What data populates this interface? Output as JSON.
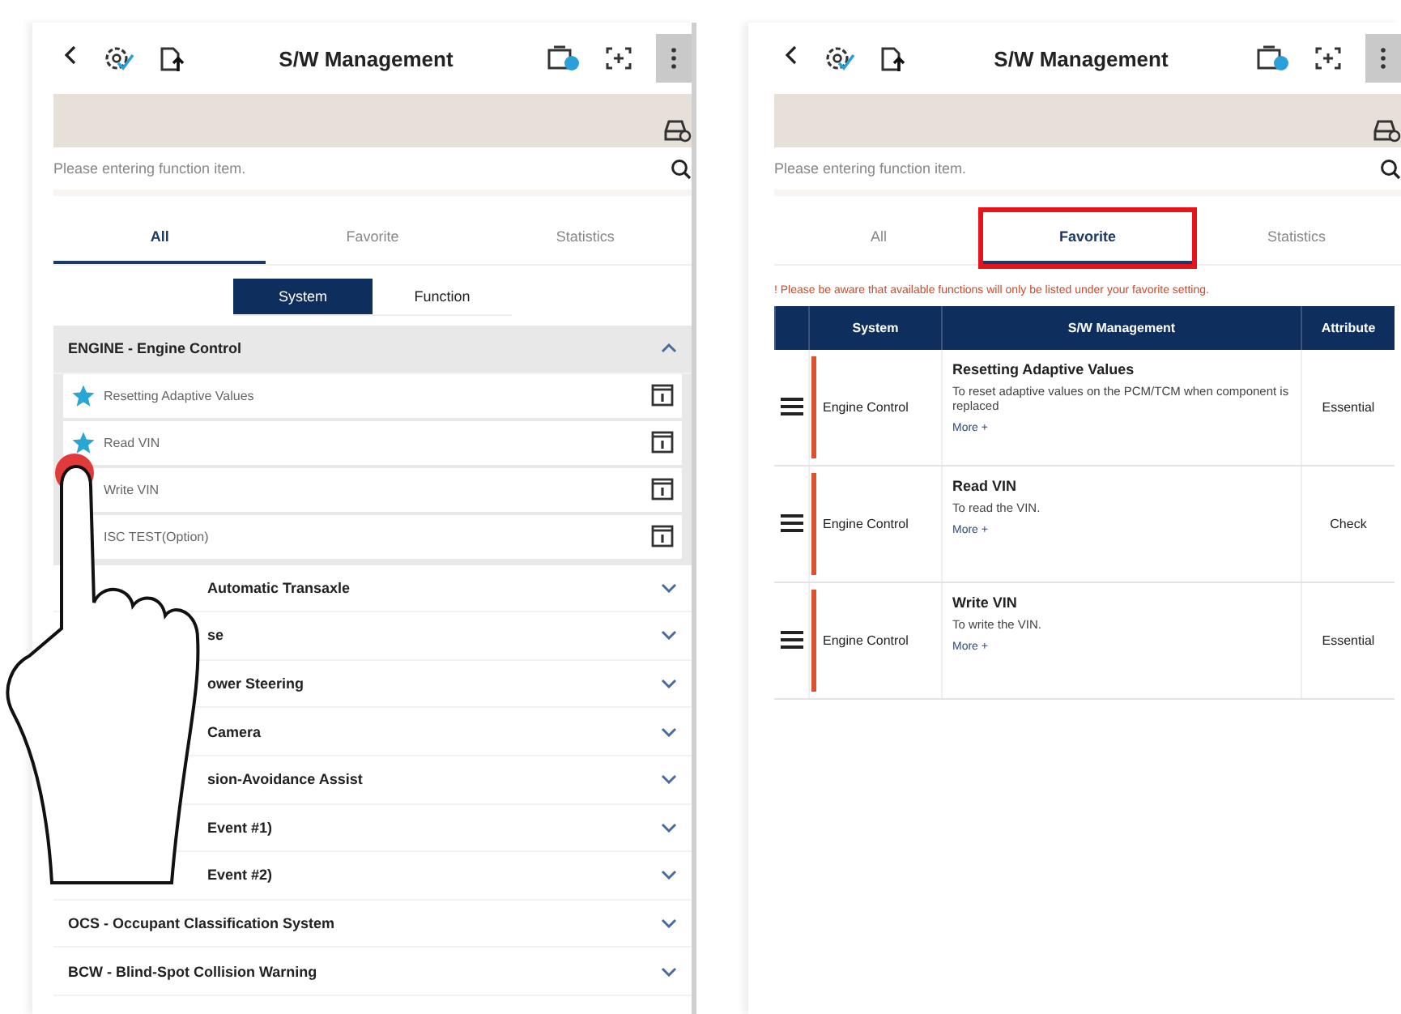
{
  "left_screen": {
    "header": {
      "title": "S/W Management"
    },
    "search": {
      "placeholder": "Please entering function item."
    },
    "tabs": [
      {
        "label": "All",
        "selected": true
      },
      {
        "label": "Favorite",
        "selected": false
      },
      {
        "label": "Statistics",
        "selected": false
      }
    ],
    "segments": [
      {
        "label": "System",
        "selected": true
      },
      {
        "label": "Function",
        "selected": false
      }
    ],
    "groups": [
      {
        "name": "ENGINE - Engine Control",
        "expanded": true,
        "covered": false,
        "items": [
          {
            "name": "Resetting Adaptive Values",
            "favorite": true
          },
          {
            "name": "Read VIN",
            "favorite": true
          },
          {
            "name": "Write VIN",
            "favorite": false
          },
          {
            "name": "ISC TEST(Option)",
            "favorite": false
          }
        ]
      },
      {
        "name": "Automatic Transaxle",
        "expanded": false,
        "covered": true
      },
      {
        "name": "se",
        "expanded": false,
        "covered": true
      },
      {
        "name": "ower Steering",
        "expanded": false,
        "covered": true
      },
      {
        "name": "Camera",
        "expanded": false,
        "covered": true
      },
      {
        "name": "sion-Avoidance Assist",
        "expanded": false,
        "covered": true
      },
      {
        "name": "Event #1)",
        "expanded": false,
        "covered": true
      },
      {
        "name": "Event #2)",
        "expanded": false,
        "covered": true
      },
      {
        "name": "OCS - Occupant Classification System",
        "expanded": false,
        "covered": false
      },
      {
        "name": "BCW - Blind-Spot Collision Warning",
        "expanded": false,
        "covered": false
      }
    ]
  },
  "right_screen": {
    "header": {
      "title": "S/W Management"
    },
    "search": {
      "placeholder": "Please entering function item."
    },
    "tabs": [
      {
        "label": "All",
        "selected": false,
        "highlighted": false
      },
      {
        "label": "Favorite",
        "selected": true,
        "highlighted": true
      },
      {
        "label": "Statistics",
        "selected": false,
        "highlighted": false
      }
    ],
    "notice": "! Please be aware that available functions will only be listed under your favorite setting.",
    "table": {
      "columns": [
        "System",
        "S/W Management",
        "Attribute"
      ],
      "rows": [
        {
          "system": "Engine Control",
          "title": "Resetting Adaptive Values",
          "description": "To reset adaptive values on the PCM/TCM when component is replaced",
          "more": "More +",
          "attribute": "Essential"
        },
        {
          "system": "Engine Control",
          "title": "Read VIN",
          "description": "To read the VIN.",
          "more": "More +",
          "attribute": "Check"
        },
        {
          "system": "Engine Control",
          "title": "Write VIN",
          "description": "To write the VIN.",
          "more": "More +",
          "attribute": "Essential"
        }
      ]
    }
  }
}
